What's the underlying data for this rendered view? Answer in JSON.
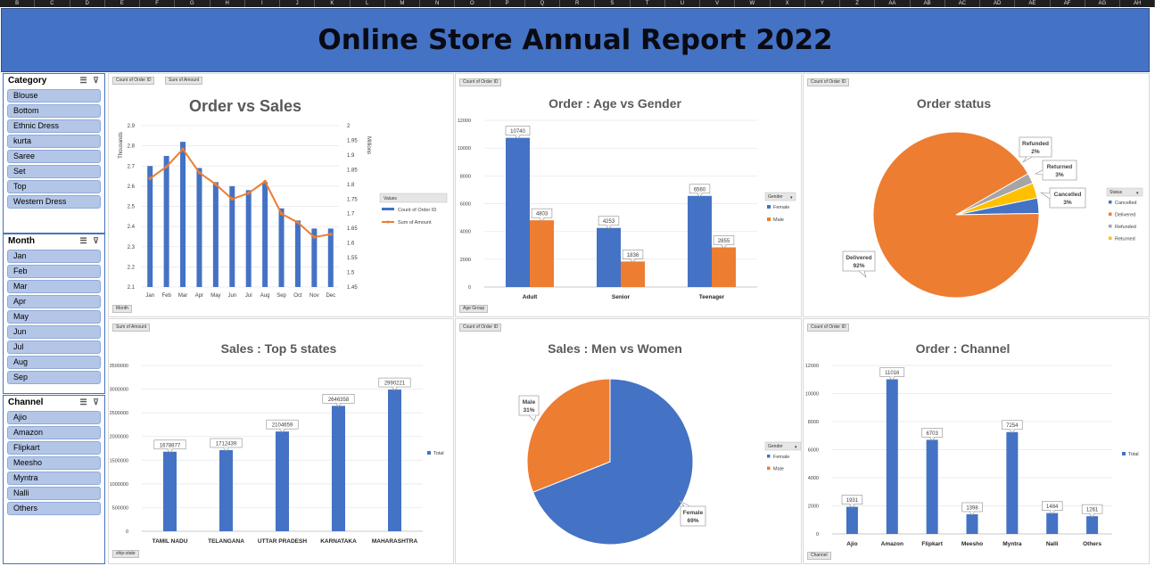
{
  "columns": [
    "B",
    "C",
    "D",
    "E",
    "F",
    "G",
    "H",
    "I",
    "J",
    "K",
    "L",
    "M",
    "N",
    "O",
    "P",
    "Q",
    "R",
    "S",
    "T",
    "U",
    "V",
    "W",
    "X",
    "Y",
    "Z",
    "AA",
    "AB",
    "AC",
    "AD",
    "AE",
    "AF",
    "AG",
    "AH"
  ],
  "title": "Online Store Annual Report 2022",
  "colors": {
    "banner": "#4472c4",
    "blue": "#4472c4",
    "orange": "#ed7d31",
    "gray": "#a5a5a5",
    "yellow": "#ffc000",
    "slicer_item": "#b4c6e7"
  },
  "slicers": {
    "category": {
      "title": "Category",
      "items": [
        "Blouse",
        "Bottom",
        "Ethnic Dress",
        "kurta",
        "Saree",
        "Set",
        "Top",
        "Western Dress"
      ]
    },
    "month": {
      "title": "Month",
      "items": [
        "Jan",
        "Feb",
        "Mar",
        "Apr",
        "May",
        "Jun",
        "Jul",
        "Aug",
        "Sep"
      ]
    },
    "channel": {
      "title": "Channel",
      "items": [
        "Ajio",
        "Amazon",
        "Flipkart",
        "Meesho",
        "Myntra",
        "Nalli",
        "Others"
      ]
    }
  },
  "pills": {
    "p1a": "Count of Order ID",
    "p1b": "Sum of Amount",
    "p1c": "Month",
    "p2a": "Count of Order ID",
    "p2b": "Age Group",
    "p3a": "Count of Order ID",
    "p4a": "Sum of Amount",
    "p4b": "ship-state",
    "p5a": "Count of Order ID",
    "p6a": "Count of Order ID",
    "p6b": "Channel"
  },
  "chart_data": [
    {
      "type": "bar",
      "title": "Order vs Sales",
      "categories": [
        "Jan",
        "Feb",
        "Mar",
        "Apr",
        "May",
        "Jun",
        "Jul",
        "Aug",
        "Sep",
        "Oct",
        "Nov",
        "Dec"
      ],
      "series": [
        {
          "name": "Count of Order ID",
          "values": [
            2.7,
            2.75,
            2.82,
            2.69,
            2.62,
            2.6,
            2.58,
            2.62,
            2.49,
            2.43,
            2.39,
            2.39
          ]
        },
        {
          "name": "Sum of Amount",
          "values": [
            1.82,
            1.86,
            1.92,
            1.84,
            1.8,
            1.75,
            1.77,
            1.81,
            1.7,
            1.67,
            1.62,
            1.63
          ]
        }
      ],
      "ylabel": "Thousands",
      "y2label": "Millions",
      "ylim": [
        2.1,
        2.9
      ],
      "y2lim": [
        1.45,
        2.0
      ],
      "yticks": [
        "2.1",
        "2.2",
        "2.3",
        "2.4",
        "2.5",
        "2.6",
        "2.7",
        "2.8",
        "2.9"
      ],
      "y2ticks": [
        "1.45",
        "1.5",
        "1.55",
        "1.6",
        "1.65",
        "1.7",
        "1.75",
        "1.8",
        "1.85",
        "1.9",
        "1.95",
        "2"
      ],
      "legend_title": "Values"
    },
    {
      "type": "bar",
      "title": "Order : Age vs Gender",
      "categories": [
        "Adult",
        "Senior",
        "Teenager"
      ],
      "series": [
        {
          "name": "Female",
          "values": [
            10740,
            4253,
            6560
          ]
        },
        {
          "name": "Male",
          "values": [
            4803,
            1836,
            2855
          ]
        }
      ],
      "ylim": [
        0,
        12000
      ],
      "yticks": [
        "0",
        "2000",
        "4000",
        "6000",
        "8000",
        "10000",
        "12000"
      ],
      "legend_title": "Gender"
    },
    {
      "type": "pie",
      "title": "Order status",
      "labels": [
        "Cancelled",
        "Delivered",
        "Refunded",
        "Returned"
      ],
      "values": [
        3,
        92,
        2,
        3
      ],
      "value_labels": [
        "3%",
        "92%",
        "2%",
        "3%"
      ],
      "legend_title": "Status"
    },
    {
      "type": "bar",
      "title": "Sales : Top 5 states",
      "categories": [
        "TAMIL NADU",
        "TELANGANA",
        "UTTAR PRADESH",
        "KARNATAKA",
        "MAHARASHTRA"
      ],
      "series": [
        {
          "name": "Total",
          "values": [
            1678877,
            1712439,
            2104659,
            2646358,
            2990221
          ]
        }
      ],
      "ylim": [
        0,
        3500000
      ],
      "yticks": [
        "0",
        "500000",
        "1000000",
        "1500000",
        "2000000",
        "2500000",
        "3000000",
        "3500000"
      ]
    },
    {
      "type": "pie",
      "title": "Sales : Men vs Women",
      "labels": [
        "Female",
        "Male"
      ],
      "values": [
        69,
        31
      ],
      "value_labels": [
        "69%",
        "31%"
      ],
      "legend_title": "Gender"
    },
    {
      "type": "bar",
      "title": "Order : Channel",
      "categories": [
        "Ajio",
        "Amazon",
        "Flipkart",
        "Meesho",
        "Myntra",
        "Nalli",
        "Others"
      ],
      "series": [
        {
          "name": "Total",
          "values": [
            1931,
            11016,
            6703,
            1398,
            7254,
            1484,
            1261
          ]
        }
      ],
      "ylim": [
        0,
        12000
      ],
      "yticks": [
        "0",
        "2000",
        "4000",
        "6000",
        "8000",
        "10000",
        "12000"
      ]
    }
  ]
}
